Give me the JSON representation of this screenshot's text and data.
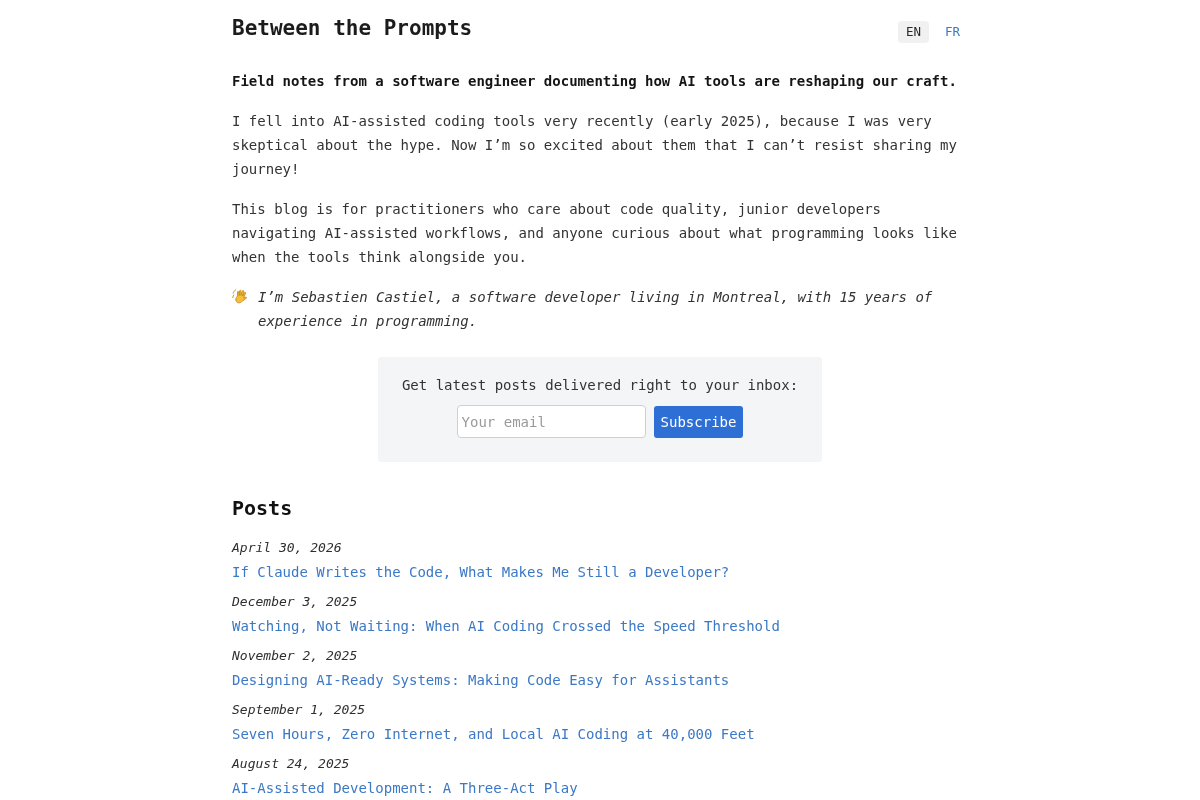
{
  "header": {
    "title": "Between the Prompts",
    "languages": [
      {
        "label": "EN",
        "selected": true
      },
      {
        "label": "FR",
        "selected": false
      }
    ]
  },
  "tagline": "Field notes from a software engineer documenting how AI tools are reshaping our craft.",
  "paragraphs": [
    "I fell into AI-assisted coding tools very recently (early 2025), because I was very skeptical about the hype. Now I’m so excited about them that I can’t resist sharing my journey!",
    "This blog is for practitioners who care about code quality, junior developers navigating AI-assisted workflows, and anyone curious about what programming looks like when the tools think alongside you."
  ],
  "author_note": "I’m Sebastien Castiel, a software developer living in Montreal, with 15 years of experience in programming.",
  "subscribe": {
    "prompt": "Get latest posts delivered right to your inbox:",
    "placeholder": "Your email",
    "button": "Subscribe"
  },
  "posts": {
    "heading": "Posts",
    "items": [
      {
        "date": "April 30, 2026",
        "title": "If Claude Writes the Code, What Makes Me Still a Developer?"
      },
      {
        "date": "December 3, 2025",
        "title": "Watching, Not Waiting: When AI Coding Crossed the Speed Threshold"
      },
      {
        "date": "November 2, 2025",
        "title": "Designing AI-Ready Systems: Making Code Easy for Assistants"
      },
      {
        "date": "September 1, 2025",
        "title": "Seven Hours, Zero Internet, and Local AI Coding at 40,000 Feet"
      },
      {
        "date": "August 24, 2025",
        "title": "AI-Assisted Development: A Three-Act Play"
      }
    ]
  }
}
